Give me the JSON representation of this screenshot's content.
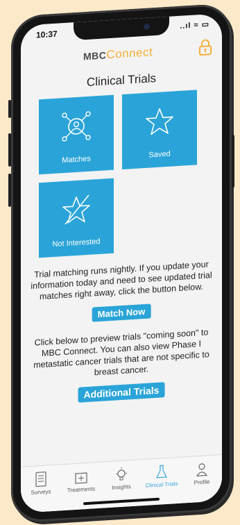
{
  "status": {
    "time": "10:37",
    "signal": "..ıl ≈ ▭"
  },
  "header": {
    "logo_mbc": "MBC",
    "logo_connect": "Connect"
  },
  "page": {
    "title": "Clinical Trials"
  },
  "tiles": [
    {
      "label": "Matches",
      "icon": "network-person-icon"
    },
    {
      "label": "Saved",
      "icon": "star-icon"
    },
    {
      "label": "Not Interested",
      "icon": "star-crossed-icon"
    }
  ],
  "text": {
    "matching_info": "Trial matching runs nightly.  If you update your information today and need to see updated trial matches right away, click the button below.",
    "match_now_button": "Match Now",
    "preview_info": "Click below to preview trials \"coming soon\" to MBC Connect. You can also view Phase I metastatic cancer trials that are not specific to breast cancer.",
    "additional_trials_button": "Additional Trials"
  },
  "tabbar": {
    "items": [
      {
        "label": "Surveys",
        "icon": "survey-icon"
      },
      {
        "label": "Treatments",
        "icon": "treatments-icon"
      },
      {
        "label": "Insights",
        "icon": "lightbulb-icon"
      },
      {
        "label": "Clinical Trials",
        "icon": "flask-icon",
        "active": true
      },
      {
        "label": "Profile",
        "icon": "profile-icon"
      }
    ]
  },
  "colors": {
    "accent": "#2aa4d8",
    "logo_accent": "#f3b13a",
    "background": "#fbe9c9"
  }
}
